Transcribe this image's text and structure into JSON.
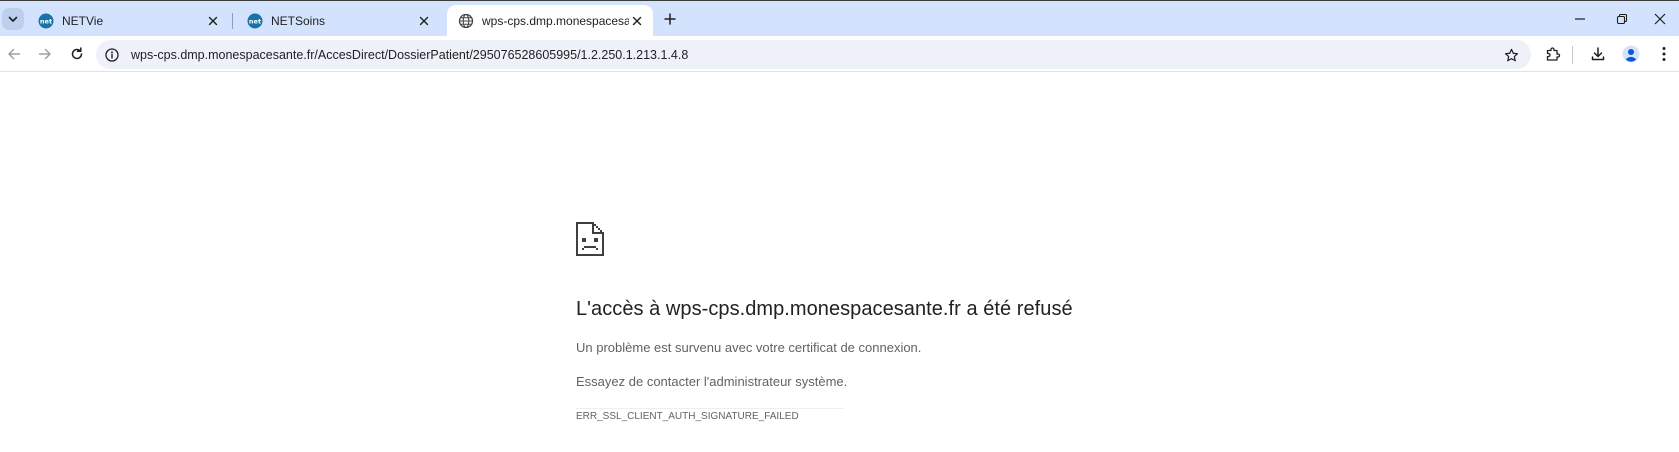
{
  "browser": {
    "tabs": [
      {
        "title": "NETVie",
        "favicon": "netvie-logo",
        "active": false
      },
      {
        "title": "NETSoins",
        "favicon": "netsoins-logo",
        "active": false
      },
      {
        "title": "wps-cps.dmp.monespacesante.fr",
        "favicon": "globe-icon",
        "active": true
      }
    ],
    "address_bar": {
      "url": "wps-cps.dmp.monespacesante.fr/AccesDirect/DossierPatient/295076528605995/1.2.250.1.213.1.4.8"
    },
    "colors": {
      "tabstrip": "#d3e3fd",
      "omnibox": "#eef1f9",
      "profile_avatar": "#0b57d0"
    }
  },
  "error_page": {
    "icon": "sad-document-icon",
    "title": "L'accès à wps-cps.dmp.monespacesante.fr a été refusé",
    "paragraph1": "Un problème est survenu avec votre certificat de connexion.",
    "paragraph2": "Essayez de contacter l'administrateur système.",
    "error_code": "ERR_SSL_CLIENT_AUTH_SIGNATURE_FAILED"
  }
}
